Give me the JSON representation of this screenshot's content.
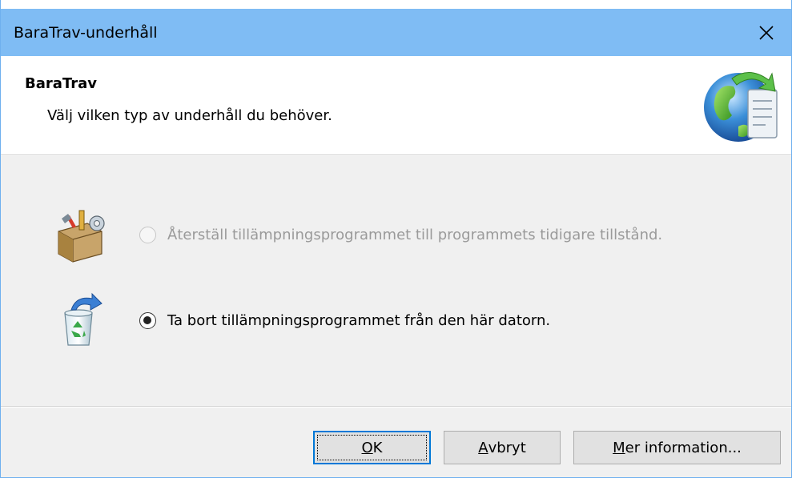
{
  "window": {
    "title": "BaraTrav-underhåll",
    "close_label": "×"
  },
  "header": {
    "title": "BaraTrav",
    "subtitle": "Välj vilken typ av underhåll du behöver."
  },
  "options": [
    {
      "label": "Återställ tillämpningsprogrammet till programmets tidigare tillstånd.",
      "checked": false,
      "disabled": true,
      "icon": "toolbox-icon"
    },
    {
      "label": "Ta bort tillämpningsprogrammet från den här datorn.",
      "checked": true,
      "disabled": false,
      "icon": "recycle-bin-icon"
    }
  ],
  "buttons": {
    "ok": {
      "mnemonic": "O",
      "rest": "K"
    },
    "cancel": {
      "mnemonic": "A",
      "rest": "vbryt"
    },
    "more": {
      "mnemonic": "M",
      "rest": "er information..."
    }
  },
  "colors": {
    "titlebar": "#7fbcf4",
    "accent": "#0078d7",
    "body": "#f0f0f0"
  }
}
